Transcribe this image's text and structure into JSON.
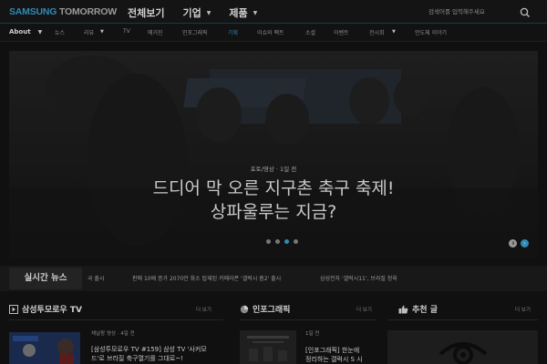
{
  "header": {
    "logo_brand": "SAMSUNG",
    "logo_suffix": " TOMORROW",
    "nav": [
      {
        "label": "전체보기",
        "has_menu": false
      },
      {
        "label": "기업",
        "has_menu": true
      },
      {
        "label": "제품",
        "has_menu": true
      }
    ],
    "search_placeholder": "검색어를 입력해주세요",
    "search_icon": "magnifier"
  },
  "subnav": {
    "about": "About",
    "items": [
      "뉴스",
      "리뷰",
      "TV",
      "메거진",
      "인포그래픽",
      "기획",
      "이슈와 팩트",
      "소셜",
      "이벤트",
      "전시회",
      "언도체 이야기"
    ],
    "selected_index": 5
  },
  "hero": {
    "meta": "포토/영상 · 1일 전",
    "title_line1": "드디어 막 오른 지구촌 축구 축제!",
    "title_line2": "상파울루는 지금?",
    "slide_count": 4,
    "active_slide": 3
  },
  "live_news": {
    "label": "실시간 뉴스",
    "items": [
      "국 출시",
      "판매 10배 증가 2070만 화소 탑재된 카메라폰 '갤럭시 줌2' 출시",
      "삼성전자 '갤럭시11', 브라질 정육"
    ]
  },
  "cards": {
    "tv": {
      "title": "삼성투모로우 TV",
      "more": "더 보기",
      "item_meta": "채널팡 영상 · 4일 전",
      "item_title_line1": "[삼성투모로우 TV #159] 삼성 TV '사커모",
      "item_title_line2": "드'로 브라질 축구열기를 그대로~!"
    },
    "infographic": {
      "title": "인포그래픽",
      "more": "더 보기",
      "item_meta": "1일 전",
      "item_title_line1": "[인포그래픽] 한눈에",
      "item_title_line2": "정리하는 갤럭시 S 시"
    },
    "recommended": {
      "title": "추천 글",
      "more": "더 보기"
    }
  },
  "colors": {
    "accent": "#2e8bb6",
    "background": "#101010",
    "text": "#c8c8c8"
  }
}
